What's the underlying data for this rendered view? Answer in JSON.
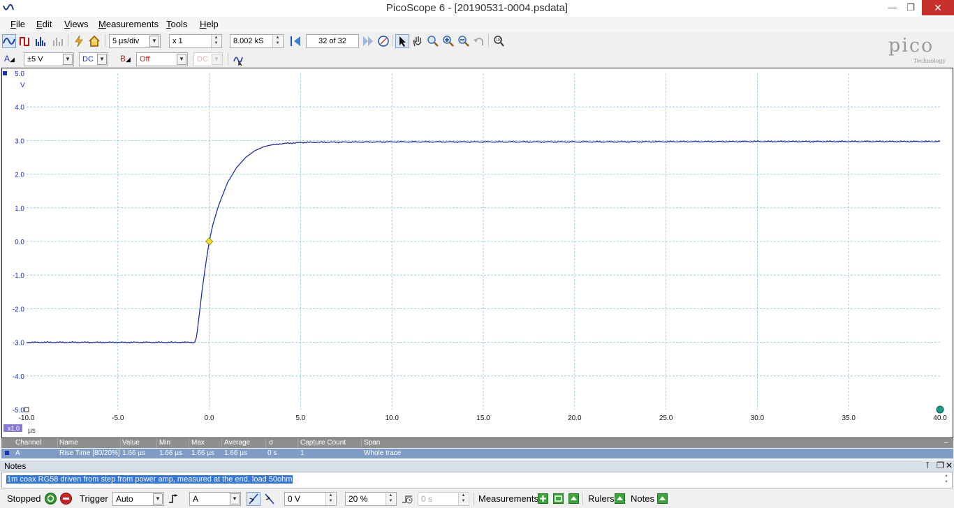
{
  "window": {
    "title": "PicoScope 6 - [20190531-0004.psdata]",
    "minimize": "—",
    "maximize": "❐",
    "close": "✕"
  },
  "menu": [
    "File",
    "Edit",
    "Views",
    "Measurements",
    "Tools",
    "Help"
  ],
  "menu_hotkeys": [
    "F",
    "E",
    "V",
    "M",
    "T",
    "H"
  ],
  "toolbar": {
    "timebase": "5 µs/div",
    "zoom": "x 1",
    "samples": "8.002 kS",
    "buffer": "32 of 32"
  },
  "channel_a": {
    "label": "A",
    "range": "±5 V",
    "coupling": "DC"
  },
  "channel_b": {
    "label": "B",
    "range": "Off",
    "coupling": "DC"
  },
  "logo": {
    "word": "pico",
    "tagline": "Technology"
  },
  "colors": {
    "trace": "#1f2da8",
    "grid": "#8fc7d3",
    "axis_text": "#1a30b8",
    "trigger_marker": "#f0e020",
    "ruler_handle": "#1a9a8a"
  },
  "chart_data": {
    "type": "line",
    "y_unit": "V",
    "x_unit": "µs",
    "x_range": [
      -10.0,
      40.0
    ],
    "y_range": [
      -5.0,
      5.0
    ],
    "x_ticks": [
      "-10.0",
      "-5.0",
      "0.0",
      "5.0",
      "10.0",
      "15.0",
      "20.0",
      "25.0",
      "30.0",
      "35.0",
      "40.0"
    ],
    "y_ticks": [
      "5.0",
      "4.0",
      "3.0",
      "2.0",
      "1.0",
      "0.0",
      "-1.0",
      "-2.0",
      "-3.0",
      "-4.0",
      "-5.0"
    ],
    "x_zoom_label": "x1.0",
    "grid": true,
    "series": [
      {
        "points": [
          [
            -10.0,
            -3.0
          ],
          [
            -2.0,
            -3.0
          ],
          [
            -0.8,
            -3.0
          ],
          [
            -0.7,
            -2.85
          ],
          [
            -0.55,
            -2.2
          ],
          [
            -0.4,
            -1.5
          ],
          [
            -0.2,
            -0.7
          ],
          [
            0.0,
            0.0
          ],
          [
            0.2,
            0.5
          ],
          [
            0.5,
            1.05
          ],
          [
            1.0,
            1.75
          ],
          [
            1.5,
            2.2
          ],
          [
            2.0,
            2.5
          ],
          [
            2.5,
            2.7
          ],
          [
            3.0,
            2.82
          ],
          [
            3.5,
            2.88
          ],
          [
            4.0,
            2.91
          ],
          [
            5.0,
            2.94
          ],
          [
            6.0,
            2.95
          ],
          [
            10.0,
            2.96
          ],
          [
            20.0,
            2.96
          ],
          [
            30.0,
            2.97
          ],
          [
            40.0,
            2.97
          ]
        ]
      }
    ],
    "trigger_point": [
      0.0,
      0.0
    ]
  },
  "measurements": {
    "headers": [
      "Channel",
      "Name",
      "Value",
      "Min",
      "Max",
      "Average",
      "σ",
      "Capture Count",
      "Span"
    ],
    "rows": [
      [
        "A",
        "Rise Time  [80/20%]",
        "1.66 µs",
        "1.66 µs",
        "1.66 µs",
        "1.66 µs",
        "0 s",
        "1",
        "Whole trace"
      ]
    ]
  },
  "notes": {
    "title": "Notes",
    "text": "1m coax RG58 driven from step from power amp, measured at the end, load 50ohm"
  },
  "status": {
    "state": "Stopped",
    "trigger_label": "Trigger",
    "trigger_mode": "Auto",
    "trigger_source": "A",
    "trigger_level": "0 V",
    "pretrigger": "20 %",
    "delay": "0 s",
    "measurements_label": "Measurements",
    "rulers_label": "Rulers",
    "notes_label": "Notes"
  }
}
